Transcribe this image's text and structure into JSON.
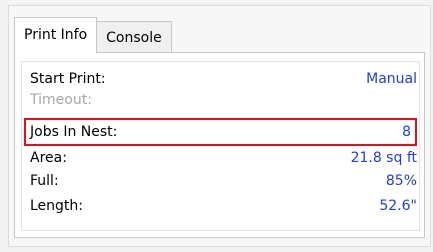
{
  "tabs": [
    {
      "label": "Print Info",
      "active": true
    },
    {
      "label": "Console",
      "active": false
    }
  ],
  "print_info": {
    "rows": [
      {
        "label": "Start Print:",
        "value": "Manual"
      },
      {
        "label": "Timeout:",
        "value": ""
      },
      {
        "label": "Jobs In Nest:",
        "value": "8"
      },
      {
        "label": "Area:",
        "value": "21.8 sq ft"
      },
      {
        "label": "Full:",
        "value": "85%"
      },
      {
        "label": "Length:",
        "value": "52.6\""
      }
    ]
  },
  "colors": {
    "value_text": "#1f3fd6",
    "highlight_border": "#e2121d",
    "disabled_text": "#a8a8a8"
  }
}
